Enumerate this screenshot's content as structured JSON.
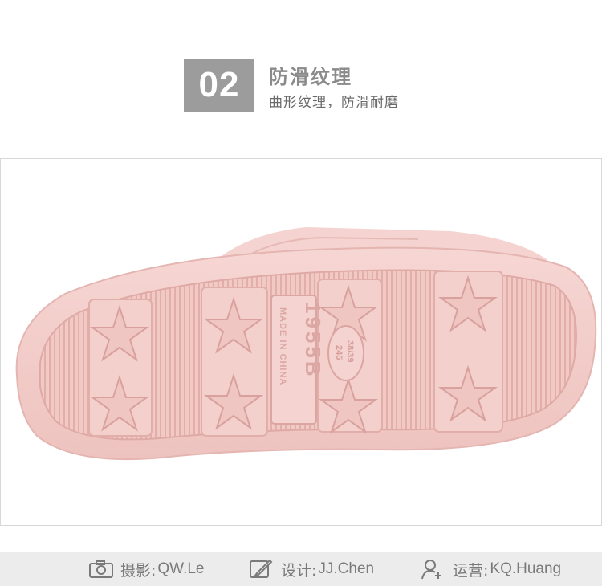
{
  "header": {
    "number": "02",
    "title": "防滑纹理",
    "subtitle": "曲形纹理，防滑耐磨"
  },
  "sole": {
    "brand_text": "1955B",
    "origin_text": "MADE IN CHINA",
    "size_top": "38/39",
    "size_bottom": "245",
    "color": "#f2cdca"
  },
  "footer": {
    "credits": [
      {
        "icon": "camera-icon",
        "label": "摄影:",
        "value": "QW.Le"
      },
      {
        "icon": "pencil-icon",
        "label": "设计:",
        "value": "JJ.Chen"
      },
      {
        "icon": "user-add-icon",
        "label": "运营:",
        "value": "KQ.Huang"
      }
    ]
  }
}
